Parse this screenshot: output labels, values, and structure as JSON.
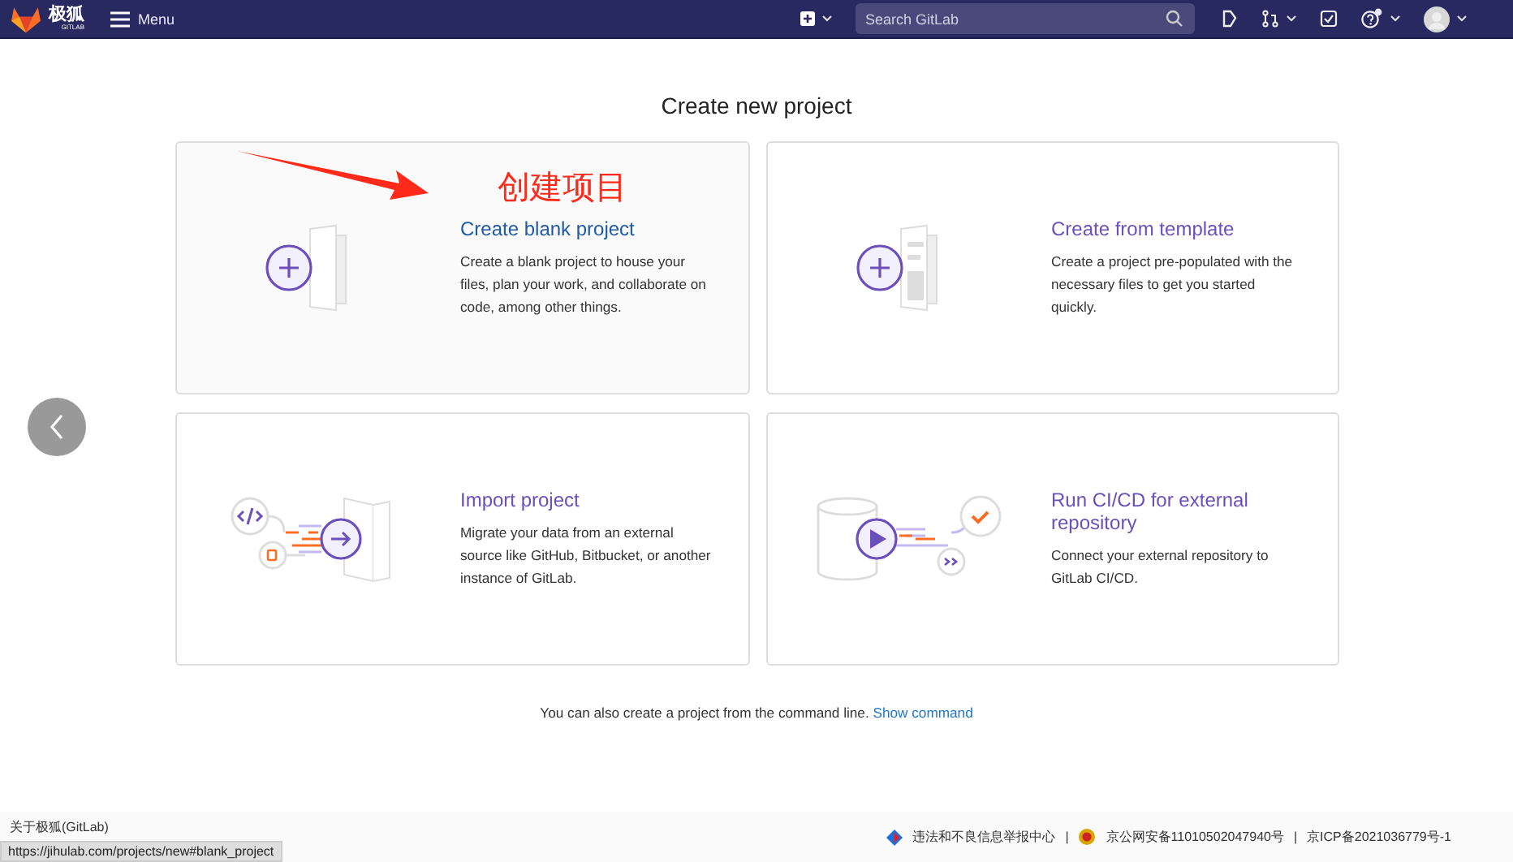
{
  "header": {
    "logo_text": "极狐",
    "logo_sub": "GITLAB",
    "menu_label": "Menu",
    "search": {
      "placeholder": "Search GitLab"
    },
    "help_notification": true
  },
  "page_title": "Create new project",
  "annotation": {
    "text": "创建项目",
    "color": "#ff2a1a"
  },
  "cards": [
    {
      "kind": "blank",
      "title": "Create blank project",
      "description": "Create a blank project to house your files, plan your work, and collaborate on code, among other things.",
      "hovered": true
    },
    {
      "kind": "template",
      "title": "Create from template",
      "description": "Create a project pre-populated with the necessary files to get you started quickly.",
      "hovered": false
    },
    {
      "kind": "import",
      "title": "Import project",
      "description": "Migrate your data from an external source like GitHub, Bitbucket, or another instance of GitLab.",
      "hovered": false
    },
    {
      "kind": "cicd",
      "title": "Run CI/CD for external repository",
      "description": "Connect your external repository to GitLab CI/CD.",
      "hovered": false
    }
  ],
  "command_hint": {
    "text": "You can also create a project from the command line.",
    "link": "Show command"
  },
  "footer": {
    "about": "关于极狐(GitLab)",
    "links": [
      {
        "kind": "report",
        "text": "违法和不良信息举报中心"
      },
      {
        "kind": "police",
        "text": "京公网安备11010502047940号"
      },
      {
        "kind": "plain",
        "text": "京ICP备2021036779号-1"
      }
    ],
    "separator": "|"
  },
  "status_url": "https://jihulab.com/projects/new#blank_project"
}
